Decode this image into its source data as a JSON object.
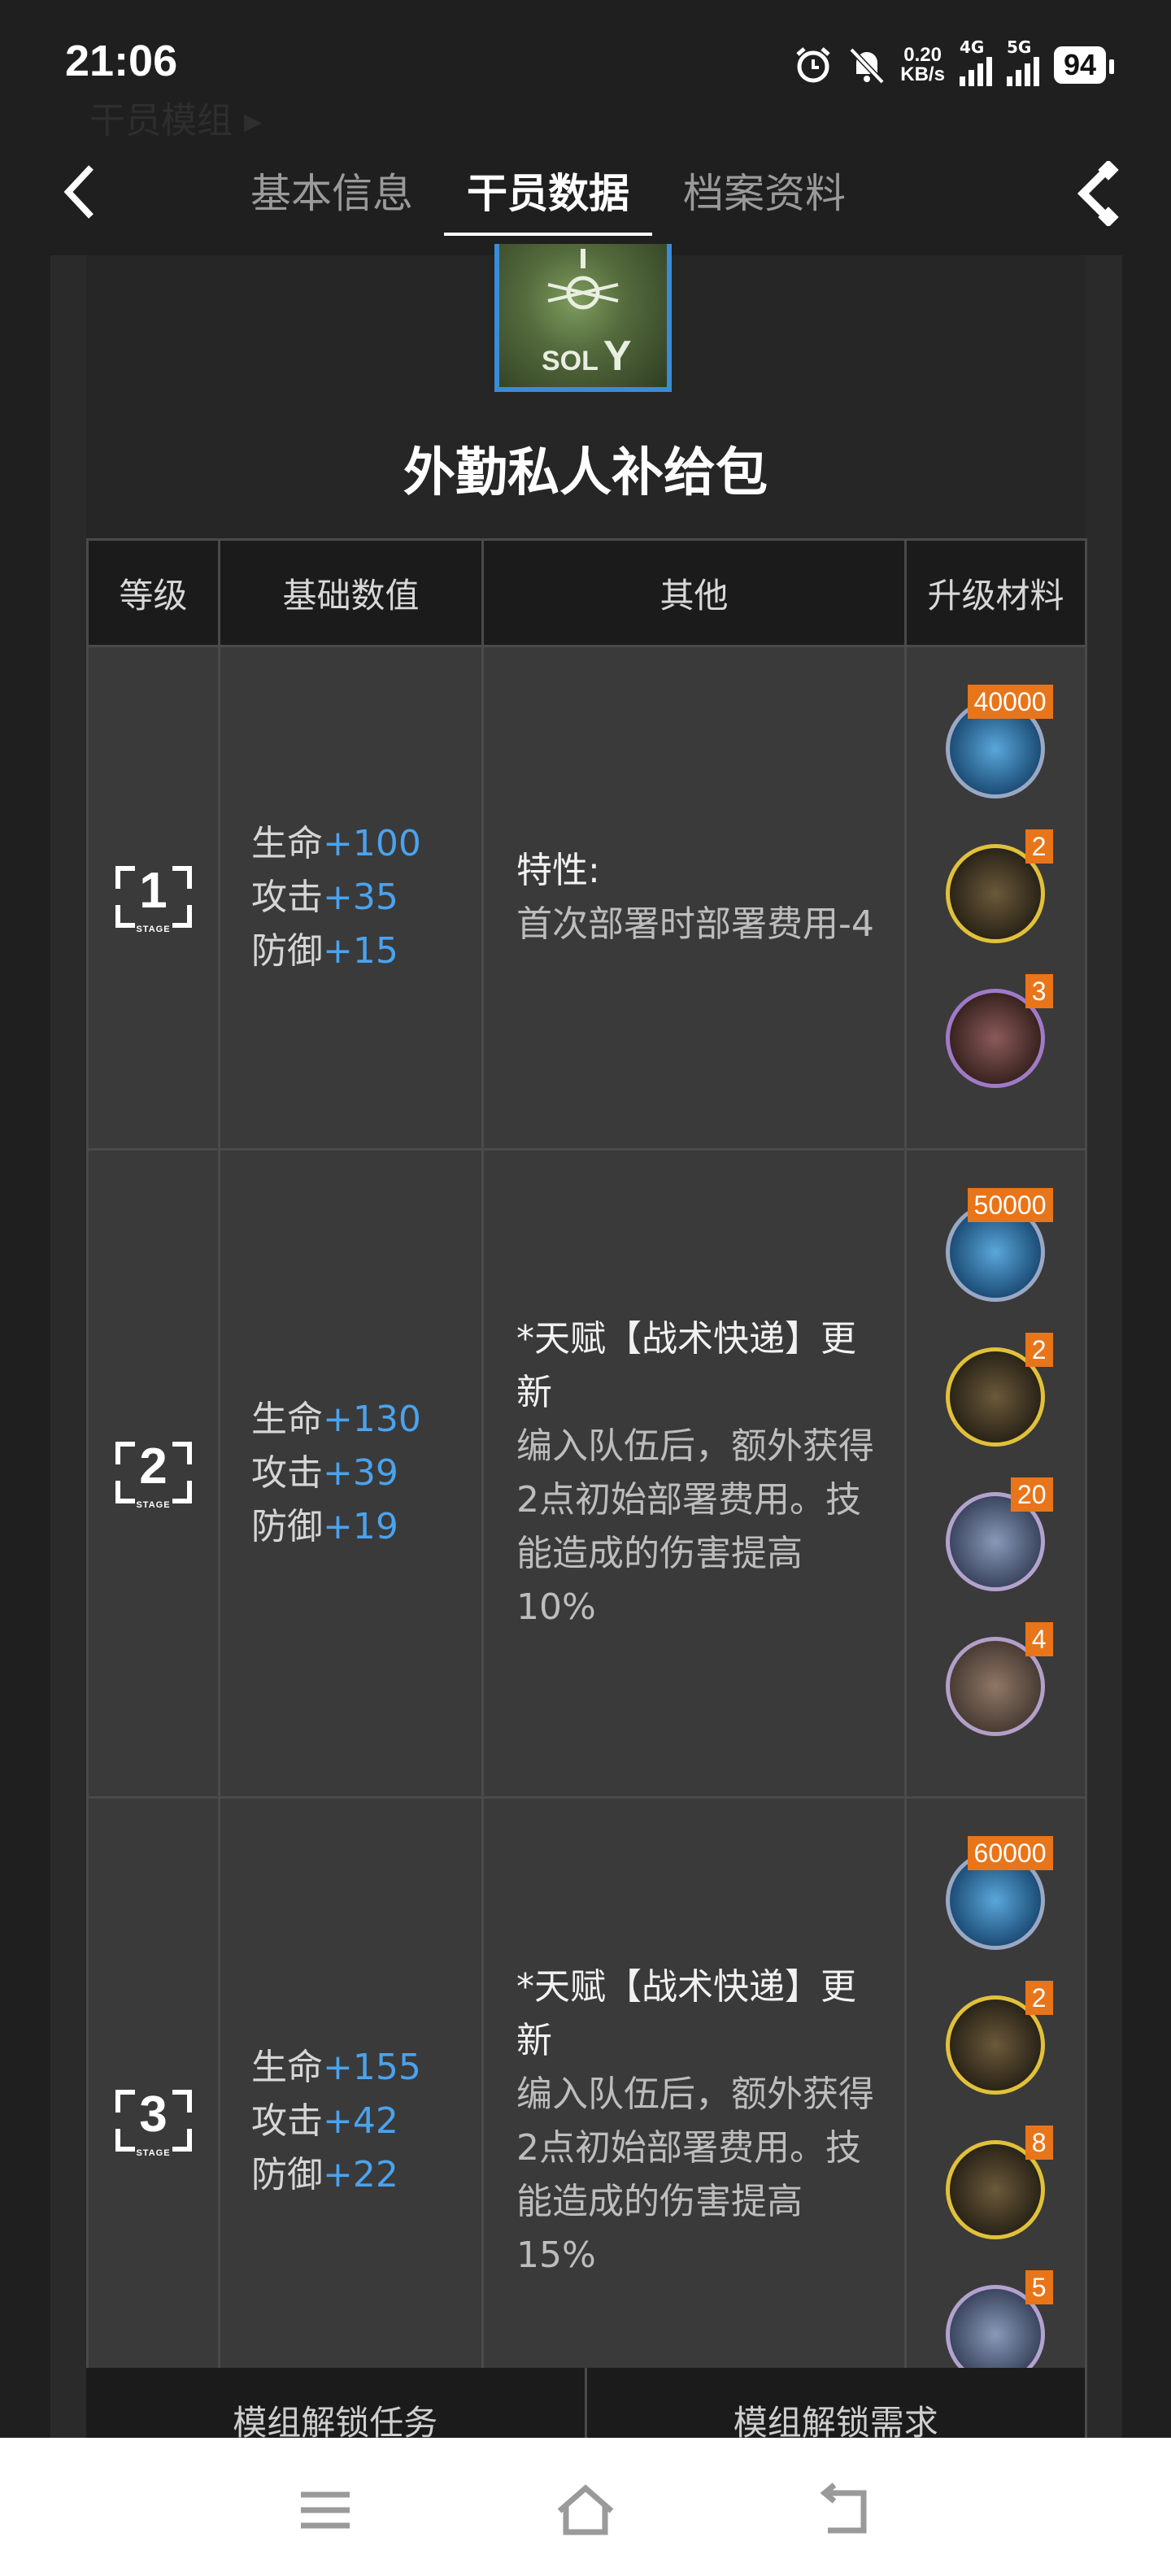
{
  "status_bar": {
    "time": "21:06",
    "net_speed_value": "0.20",
    "net_speed_unit": "KB/s",
    "sim1_label": "4G",
    "sim2_label": "5G",
    "battery": "94",
    "icons": [
      "alarm-icon",
      "mute-icon",
      "signal-icon",
      "signal-icon",
      "battery-icon"
    ]
  },
  "page": {
    "ghost_title": "干员模组 ▸",
    "tabs": [
      {
        "label": "基本信息",
        "active": false
      },
      {
        "label": "干员数据",
        "active": true
      },
      {
        "label": "档案资料",
        "active": false
      }
    ]
  },
  "module": {
    "icon_label": "SOL",
    "icon_letter": "Y",
    "name": "外勤私人补给包"
  },
  "table": {
    "headers": [
      "等级",
      "基础数值",
      "其他",
      "升级材料"
    ],
    "rows": [
      {
        "stage": "1",
        "stage_text": "STAGE",
        "stats": [
          {
            "label": "生命",
            "value": "+100"
          },
          {
            "label": "攻击",
            "value": "+35"
          },
          {
            "label": "防御",
            "value": "+15"
          }
        ],
        "other_head": "特性:",
        "other_body": "首次部署时部署费用-4",
        "materials": [
          {
            "icon": "data-chip-icon",
            "count": "40000"
          },
          {
            "icon": "module-data-block-icon",
            "count": "2"
          },
          {
            "icon": "crystal-icon",
            "count": "3"
          }
        ]
      },
      {
        "stage": "2",
        "stage_text": "STAGE",
        "stats": [
          {
            "label": "生命",
            "value": "+130"
          },
          {
            "label": "攻击",
            "value": "+39"
          },
          {
            "label": "防御",
            "value": "+19"
          }
        ],
        "other_head": "*天赋【战术快递】更新",
        "other_body": "编入队伍后，额外获得2点初始部署费用。技能造成的伤害提高10%",
        "materials": [
          {
            "icon": "data-chip-icon",
            "count": "50000"
          },
          {
            "icon": "module-data-block-icon",
            "count": "2"
          },
          {
            "icon": "alloy-block-icon",
            "count": "20"
          },
          {
            "icon": "plate-icon",
            "count": "4"
          }
        ]
      },
      {
        "stage": "3",
        "stage_text": "STAGE",
        "stats": [
          {
            "label": "生命",
            "value": "+155"
          },
          {
            "label": "攻击",
            "value": "+42"
          },
          {
            "label": "防御",
            "value": "+22"
          }
        ],
        "other_head": "*天赋【战术快递】更新",
        "other_body": "编入队伍后，额外获得2点初始部署费用。技能造成的伤害提高15%",
        "materials": [
          {
            "icon": "data-chip-icon",
            "count": "60000"
          },
          {
            "icon": "module-data-block-icon",
            "count": "2"
          },
          {
            "icon": "device-icon",
            "count": "8"
          },
          {
            "icon": "cube-icon",
            "count": "5"
          }
        ]
      }
    ]
  },
  "bottom_tabs": [
    "模组解锁任务",
    "模组解锁需求"
  ]
}
